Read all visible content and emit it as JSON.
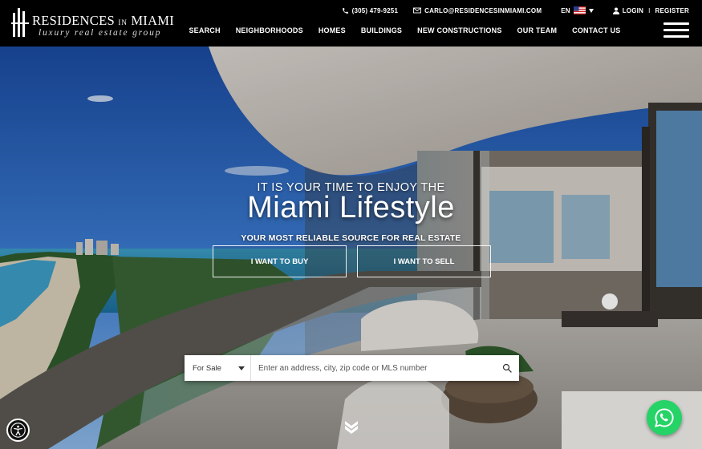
{
  "brand": {
    "name_main": "RESIDENCES",
    "name_small": "IN",
    "name_city": "MIAMI",
    "subtitle": "luxury real estate group"
  },
  "topbar": {
    "phone": "(305) 479-9251",
    "email": "CARLO@RESIDENCESINMIAMI.COM",
    "language": "EN",
    "login": "LOGIN",
    "separator": "I",
    "register": "REGISTER"
  },
  "nav": {
    "items": [
      "SEARCH",
      "NEIGHBORHOODS",
      "HOMES",
      "BUILDINGS",
      "NEW CONSTRUCTIONS",
      "OUR TEAM",
      "CONTACT US"
    ]
  },
  "hero": {
    "eyebrow": "IT IS YOUR TIME TO ENJOY THE",
    "headline": "Miami Lifestyle",
    "tagline": "YOUR MOST RELIABLE SOURCE FOR REAL ESTATE",
    "buy_label": "I WANT TO BUY",
    "sell_label": "I WANT TO SELL"
  },
  "search": {
    "type_value": "For Sale",
    "placeholder": "Enter an address, city, zip code or MLS number"
  },
  "icons": {
    "phone": "phone-icon",
    "email": "envelope-icon",
    "flag": "us-flag-icon",
    "user": "user-icon",
    "menu": "hamburger-icon",
    "search": "search-icon",
    "scroll": "double-chevron-down-icon",
    "accessibility": "accessibility-icon",
    "whatsapp": "whatsapp-icon"
  },
  "colors": {
    "header_bg": "#000000",
    "whatsapp": "#25d366",
    "text": "#ffffff"
  }
}
